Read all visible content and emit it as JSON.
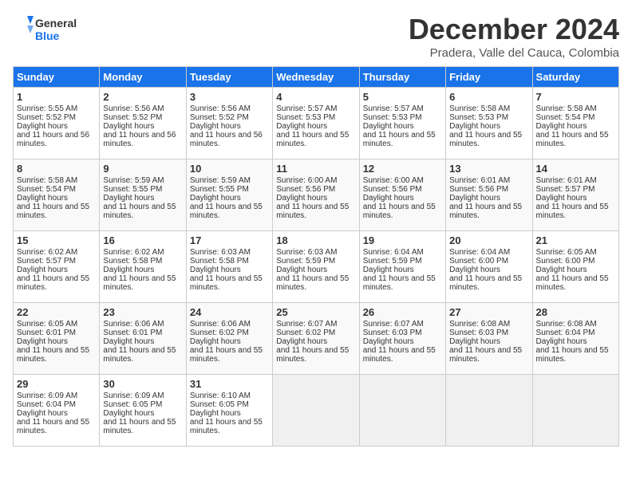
{
  "header": {
    "logo_line1": "General",
    "logo_line2": "Blue",
    "month_year": "December 2024",
    "location": "Pradera, Valle del Cauca, Colombia"
  },
  "days_of_week": [
    "Sunday",
    "Monday",
    "Tuesday",
    "Wednesday",
    "Thursday",
    "Friday",
    "Saturday"
  ],
  "weeks": [
    [
      {
        "day": 1,
        "sunrise": "5:55 AM",
        "sunset": "5:52 PM",
        "daylight": "11 hours and 56 minutes."
      },
      {
        "day": 2,
        "sunrise": "5:56 AM",
        "sunset": "5:52 PM",
        "daylight": "11 hours and 56 minutes."
      },
      {
        "day": 3,
        "sunrise": "5:56 AM",
        "sunset": "5:52 PM",
        "daylight": "11 hours and 56 minutes."
      },
      {
        "day": 4,
        "sunrise": "5:57 AM",
        "sunset": "5:53 PM",
        "daylight": "11 hours and 55 minutes."
      },
      {
        "day": 5,
        "sunrise": "5:57 AM",
        "sunset": "5:53 PM",
        "daylight": "11 hours and 55 minutes."
      },
      {
        "day": 6,
        "sunrise": "5:58 AM",
        "sunset": "5:53 PM",
        "daylight": "11 hours and 55 minutes."
      },
      {
        "day": 7,
        "sunrise": "5:58 AM",
        "sunset": "5:54 PM",
        "daylight": "11 hours and 55 minutes."
      }
    ],
    [
      {
        "day": 8,
        "sunrise": "5:58 AM",
        "sunset": "5:54 PM",
        "daylight": "11 hours and 55 minutes."
      },
      {
        "day": 9,
        "sunrise": "5:59 AM",
        "sunset": "5:55 PM",
        "daylight": "11 hours and 55 minutes."
      },
      {
        "day": 10,
        "sunrise": "5:59 AM",
        "sunset": "5:55 PM",
        "daylight": "11 hours and 55 minutes."
      },
      {
        "day": 11,
        "sunrise": "6:00 AM",
        "sunset": "5:56 PM",
        "daylight": "11 hours and 55 minutes."
      },
      {
        "day": 12,
        "sunrise": "6:00 AM",
        "sunset": "5:56 PM",
        "daylight": "11 hours and 55 minutes."
      },
      {
        "day": 13,
        "sunrise": "6:01 AM",
        "sunset": "5:56 PM",
        "daylight": "11 hours and 55 minutes."
      },
      {
        "day": 14,
        "sunrise": "6:01 AM",
        "sunset": "5:57 PM",
        "daylight": "11 hours and 55 minutes."
      }
    ],
    [
      {
        "day": 15,
        "sunrise": "6:02 AM",
        "sunset": "5:57 PM",
        "daylight": "11 hours and 55 minutes."
      },
      {
        "day": 16,
        "sunrise": "6:02 AM",
        "sunset": "5:58 PM",
        "daylight": "11 hours and 55 minutes."
      },
      {
        "day": 17,
        "sunrise": "6:03 AM",
        "sunset": "5:58 PM",
        "daylight": "11 hours and 55 minutes."
      },
      {
        "day": 18,
        "sunrise": "6:03 AM",
        "sunset": "5:59 PM",
        "daylight": "11 hours and 55 minutes."
      },
      {
        "day": 19,
        "sunrise": "6:04 AM",
        "sunset": "5:59 PM",
        "daylight": "11 hours and 55 minutes."
      },
      {
        "day": 20,
        "sunrise": "6:04 AM",
        "sunset": "6:00 PM",
        "daylight": "11 hours and 55 minutes."
      },
      {
        "day": 21,
        "sunrise": "6:05 AM",
        "sunset": "6:00 PM",
        "daylight": "11 hours and 55 minutes."
      }
    ],
    [
      {
        "day": 22,
        "sunrise": "6:05 AM",
        "sunset": "6:01 PM",
        "daylight": "11 hours and 55 minutes."
      },
      {
        "day": 23,
        "sunrise": "6:06 AM",
        "sunset": "6:01 PM",
        "daylight": "11 hours and 55 minutes."
      },
      {
        "day": 24,
        "sunrise": "6:06 AM",
        "sunset": "6:02 PM",
        "daylight": "11 hours and 55 minutes."
      },
      {
        "day": 25,
        "sunrise": "6:07 AM",
        "sunset": "6:02 PM",
        "daylight": "11 hours and 55 minutes."
      },
      {
        "day": 26,
        "sunrise": "6:07 AM",
        "sunset": "6:03 PM",
        "daylight": "11 hours and 55 minutes."
      },
      {
        "day": 27,
        "sunrise": "6:08 AM",
        "sunset": "6:03 PM",
        "daylight": "11 hours and 55 minutes."
      },
      {
        "day": 28,
        "sunrise": "6:08 AM",
        "sunset": "6:04 PM",
        "daylight": "11 hours and 55 minutes."
      }
    ],
    [
      {
        "day": 29,
        "sunrise": "6:09 AM",
        "sunset": "6:04 PM",
        "daylight": "11 hours and 55 minutes."
      },
      {
        "day": 30,
        "sunrise": "6:09 AM",
        "sunset": "6:05 PM",
        "daylight": "11 hours and 55 minutes."
      },
      {
        "day": 31,
        "sunrise": "6:10 AM",
        "sunset": "6:05 PM",
        "daylight": "11 hours and 55 minutes."
      },
      null,
      null,
      null,
      null
    ]
  ]
}
